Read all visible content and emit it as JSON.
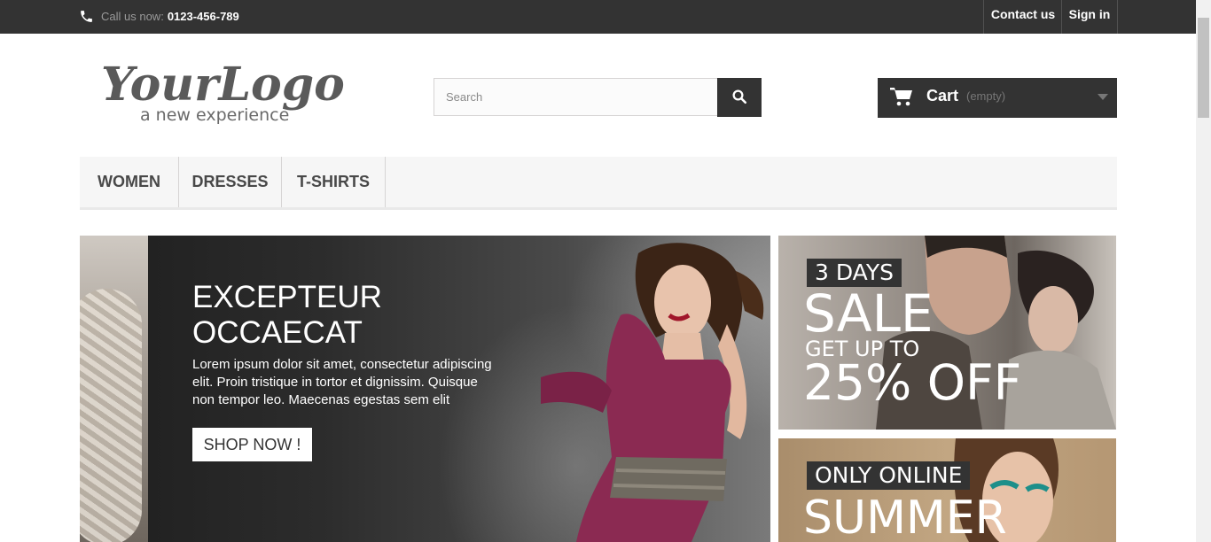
{
  "topbar": {
    "call_label": "Call us now:",
    "phone": "0123-456-789",
    "contact_label": "Contact us",
    "signin_label": "Sign in"
  },
  "logo": {
    "main": "YourLogo",
    "tagline": "a new experience"
  },
  "search": {
    "placeholder": "Search",
    "value": ""
  },
  "cart": {
    "label": "Cart",
    "status": "(empty)"
  },
  "menu": {
    "items": [
      {
        "label": "WOMEN"
      },
      {
        "label": "DRESSES"
      },
      {
        "label": "T-SHIRTS"
      }
    ]
  },
  "slide": {
    "title": "EXCEPTEUR OCCAECAT",
    "text": "Lorem ipsum dolor sit amet, consectetur adipiscing elit. Proin tristique in tortor et dignissim. Quisque non tempor leo. Maecenas egestas sem elit",
    "button": "SHOP NOW !"
  },
  "banners": [
    {
      "tag": "3 DAYS",
      "headline": "SALE",
      "subline": "GET UP TO",
      "offer": "25% OFF"
    },
    {
      "tag": "ONLY ONLINE",
      "headline": "SUMMER"
    }
  ],
  "colors": {
    "dark": "#333333",
    "menu_bg": "#f6f6f6",
    "dress": "#8b2a52"
  },
  "icons": [
    "phone-icon",
    "search-icon",
    "cart-icon",
    "chevron-down-icon"
  ]
}
